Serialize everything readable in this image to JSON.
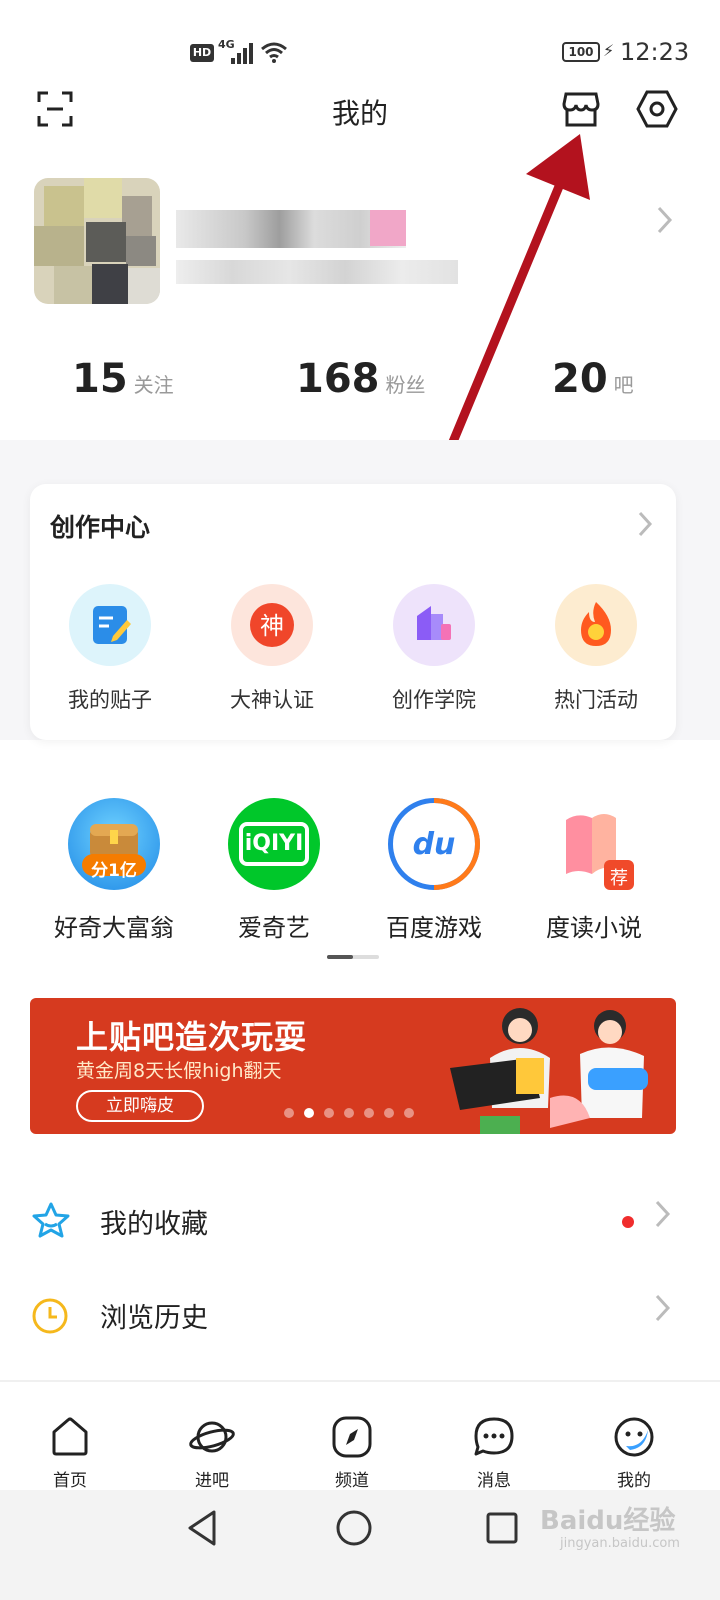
{
  "status_bar": {
    "hd": "HD",
    "network": "4G",
    "battery": "100",
    "time": "12:23"
  },
  "header": {
    "title": "我的",
    "left_icon": "scan-icon",
    "right_icons": [
      "shop-icon",
      "settings-icon"
    ]
  },
  "profile": {
    "stats": [
      {
        "num": "15",
        "label": "关注"
      },
      {
        "num": "168",
        "label": "粉丝"
      },
      {
        "num": "20",
        "label": "吧"
      }
    ]
  },
  "creation_center": {
    "title": "创作中心",
    "items": [
      {
        "label": "我的贴子",
        "icon": "edit-note-icon",
        "color": "#2196f3"
      },
      {
        "label": "大神认证",
        "icon": "god-badge-icon",
        "glyph": "神",
        "color": "#f0462a"
      },
      {
        "label": "创作学院",
        "icon": "academy-icon",
        "color": "#8b5cf6"
      },
      {
        "label": "热门活动",
        "icon": "flame-icon",
        "color": "#ff5a1f"
      }
    ]
  },
  "apps": [
    {
      "label": "好奇大富翁",
      "icon": "treasure-chest-icon",
      "badge": "分1亿"
    },
    {
      "label": "爱奇艺",
      "icon": "iqiyi-icon",
      "text": "iQIYI"
    },
    {
      "label": "百度游戏",
      "icon": "baidu-game-icon",
      "text": "du"
    },
    {
      "label": "度读小说",
      "icon": "book-icon",
      "badge": "荐"
    }
  ],
  "banner": {
    "title": "上贴吧造次玩耍",
    "subtitle": "黄金周8天长假high翻天",
    "button": "立即嗨皮",
    "dots": 7,
    "active_dot": 1,
    "color": "#d63a1f"
  },
  "list": [
    {
      "label": "我的收藏",
      "icon": "star-icon",
      "has_dot": true
    },
    {
      "label": "浏览历史",
      "icon": "clock-icon",
      "has_dot": false
    }
  ],
  "tabs": [
    {
      "label": "首页",
      "icon": "home-icon"
    },
    {
      "label": "进吧",
      "icon": "planet-icon"
    },
    {
      "label": "频道",
      "icon": "compass-icon"
    },
    {
      "label": "消息",
      "icon": "message-icon"
    },
    {
      "label": "我的",
      "icon": "profile-face-icon",
      "active": true
    }
  ],
  "watermark": {
    "text": "Baidu经验",
    "sub": "jingyan.baidu.com"
  },
  "accent": "#c1121f"
}
